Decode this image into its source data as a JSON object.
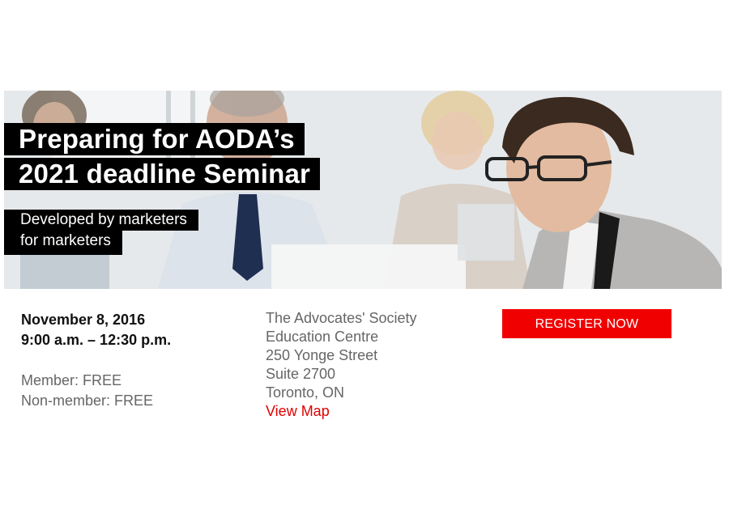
{
  "banner": {
    "headline_line1": "Preparing for AODA’s",
    "headline_line2": "2021 deadline Seminar",
    "subheadline_line1": "Developed by marketers",
    "subheadline_line2": "for marketers"
  },
  "event": {
    "date": "November 8, 2016",
    "time": "9:00 a.m. – 12:30 p.m.",
    "member_price": "Member: FREE",
    "nonmember_price": "Non-member: FREE"
  },
  "location": {
    "line1": "The Advocates' Society",
    "line2": "Education Centre",
    "line3": "250 Yonge Street",
    "line4": "Suite 2700",
    "line5": "Toronto, ON",
    "map_link": "View Map"
  },
  "register": {
    "label": "REGISTER NOW"
  },
  "colors": {
    "accent_red": "#f00000",
    "banner_text_bg": "#000000",
    "secondary_text": "#666666"
  }
}
